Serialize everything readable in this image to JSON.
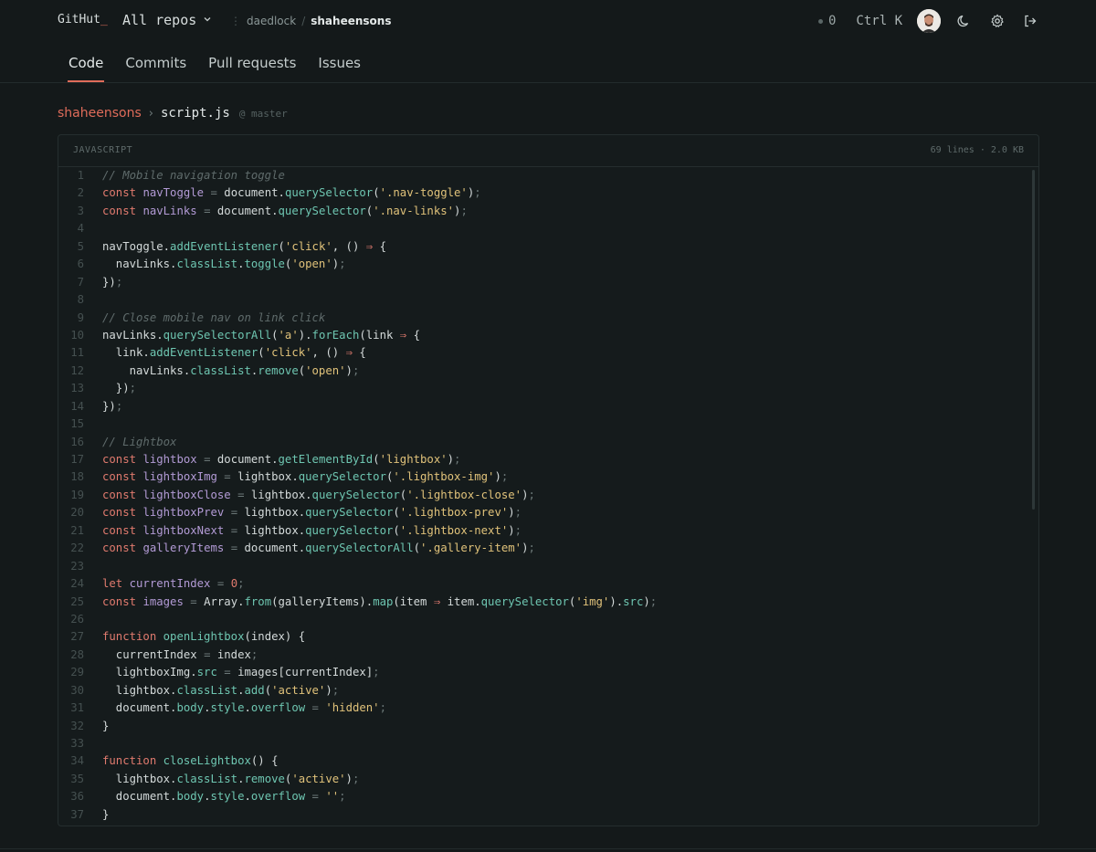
{
  "brand": {
    "name": "GitHut",
    "cursor": "_"
  },
  "repo_switcher": {
    "label": "All repos"
  },
  "breadcrumb": {
    "owner": "daedlock",
    "separator": "/",
    "repo": "shaheensons"
  },
  "topbar": {
    "status_count": "0",
    "shortcut": "Ctrl K"
  },
  "tabs": [
    {
      "label": "Code",
      "active": true
    },
    {
      "label": "Commits",
      "active": false
    },
    {
      "label": "Pull requests",
      "active": false
    },
    {
      "label": "Issues",
      "active": false
    }
  ],
  "file_path": {
    "owner": "shaheensons",
    "separator": "›",
    "file": "script.js",
    "branch": "@ master"
  },
  "file_header": {
    "language": "JAVASCRIPT",
    "lines": "69 lines",
    "size": "2.0 KB"
  },
  "colors": {
    "accent": "#e06c5a",
    "background": "#14191a"
  },
  "code_lines": [
    "// Mobile navigation toggle",
    "const navToggle = document.querySelector('.nav-toggle');",
    "const navLinks = document.querySelector('.nav-links');",
    "",
    "navToggle.addEventListener('click', () ⇒ {",
    "  navLinks.classList.toggle('open');",
    "});",
    "",
    "// Close mobile nav on link click",
    "navLinks.querySelectorAll('a').forEach(link ⇒ {",
    "  link.addEventListener('click', () ⇒ {",
    "    navLinks.classList.remove('open');",
    "  });",
    "});",
    "",
    "// Lightbox",
    "const lightbox = document.getElementById('lightbox');",
    "const lightboxImg = lightbox.querySelector('.lightbox-img');",
    "const lightboxClose = lightbox.querySelector('.lightbox-close');",
    "const lightboxPrev = lightbox.querySelector('.lightbox-prev');",
    "const lightboxNext = lightbox.querySelector('.lightbox-next');",
    "const galleryItems = document.querySelectorAll('.gallery-item');",
    "",
    "let currentIndex = 0;",
    "const images = Array.from(galleryItems).map(item ⇒ item.querySelector('img').src);",
    "",
    "function openLightbox(index) {",
    "  currentIndex = index;",
    "  lightboxImg.src = images[currentIndex];",
    "  lightbox.classList.add('active');",
    "  document.body.style.overflow = 'hidden';",
    "}",
    "",
    "function closeLightbox() {",
    "  lightbox.classList.remove('active');",
    "  document.body.style.overflow = '';",
    "}"
  ]
}
